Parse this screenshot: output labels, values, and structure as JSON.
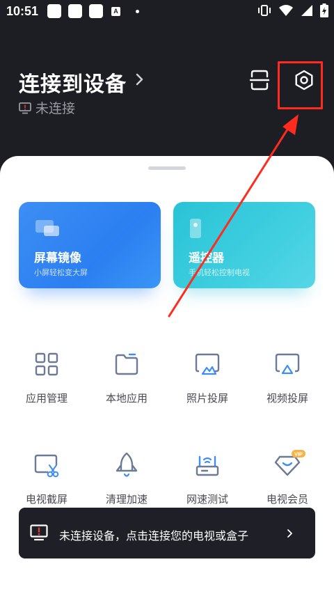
{
  "status_bar": {
    "time": "10:51",
    "notification_icons": [
      "app-notification",
      "app-notification",
      "app-notification",
      "text-a-icon",
      "dot-icon"
    ],
    "system_icons": [
      "vibrate-icon",
      "wifi-icon",
      "signal-icon",
      "battery-charging-icon"
    ]
  },
  "header": {
    "title": "连接到设备",
    "subtitle": "未连接",
    "scan_icon": "scan-icon",
    "settings_icon": "settings-hexagon-icon"
  },
  "feature_cards": [
    {
      "title": "屏幕镜像",
      "subtitle": "小屏轻松变大屏",
      "icon": "screen-mirror-icon",
      "color": "#2f84f2"
    },
    {
      "title": "遥控器",
      "subtitle": "手机轻松控制电视",
      "icon": "remote-icon",
      "color": "#33c8dc"
    }
  ],
  "tools_row1": [
    {
      "label": "应用管理",
      "icon": "app-grid-icon"
    },
    {
      "label": "本地应用",
      "icon": "folder-icon"
    },
    {
      "label": "照片投屏",
      "icon": "photo-cast-icon"
    },
    {
      "label": "视频投屏",
      "icon": "video-cast-icon"
    }
  ],
  "tools_row2": [
    {
      "label": "电视截屏",
      "icon": "tv-screenshot-icon"
    },
    {
      "label": "清理加速",
      "icon": "rocket-icon"
    },
    {
      "label": "网速测试",
      "icon": "router-icon"
    },
    {
      "label": "电视会员",
      "icon": "vip-diamond-icon",
      "badge": "VIP"
    }
  ],
  "toast": {
    "text": "未连接设备，点击连接您的电视或盒子",
    "icon": "tv-alert-icon"
  },
  "colors": {
    "header_bg": "#1d1e24",
    "icon_blue_gray": "#6c7b95",
    "icon_accent": "#3d8ef4",
    "highlight_red": "#ff2b1f",
    "vip_orange": "#f5b445"
  }
}
